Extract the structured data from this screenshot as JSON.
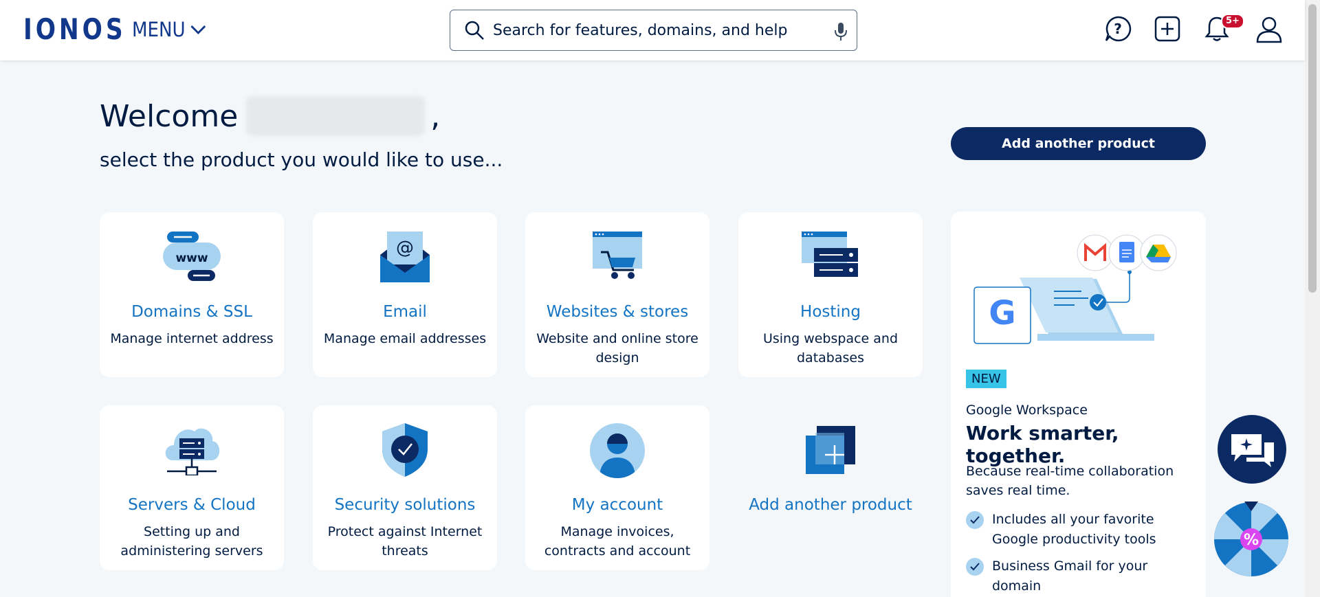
{
  "header": {
    "logo": "IONOS",
    "menu_label": "MENU",
    "search_placeholder": "Search for features, domains, and help",
    "notification_badge": "5+"
  },
  "welcome": {
    "greeting": "Welcome",
    "comma": ",",
    "subtitle": "select the product you would like to use...",
    "add_button": "Add another product"
  },
  "products": [
    {
      "title": "Domains & SSL",
      "desc": "Manage internet address",
      "icon": "www-icon"
    },
    {
      "title": "Email",
      "desc": "Manage email addresses",
      "icon": "email-icon"
    },
    {
      "title": "Websites & stores",
      "desc": "Website and online store design",
      "icon": "store-icon"
    },
    {
      "title": "Hosting",
      "desc": "Using webspace and databases",
      "icon": "server-icon"
    },
    {
      "title": "Servers & Cloud",
      "desc": "Setting up and administering servers",
      "icon": "cloud-server-icon"
    },
    {
      "title": "Security solutions",
      "desc": "Protect against Internet threats",
      "icon": "shield-icon"
    },
    {
      "title": "My account",
      "desc": "Manage invoices, contracts and account",
      "icon": "user-icon"
    },
    {
      "title": "Add another product",
      "desc": "",
      "icon": "plus-square-icon"
    }
  ],
  "promo": {
    "tag": "NEW",
    "subtitle": "Google Workspace",
    "headline": "Work smarter, together.",
    "text": "Because real-time collaboration saves real time.",
    "bullets": [
      "Includes all your favorite Google productivity tools",
      "Business Gmail for your domain"
    ]
  },
  "colors": {
    "brand": "#11388a",
    "link": "#1474c4",
    "dark": "#0b2a63",
    "background": "#f4f7fa"
  }
}
